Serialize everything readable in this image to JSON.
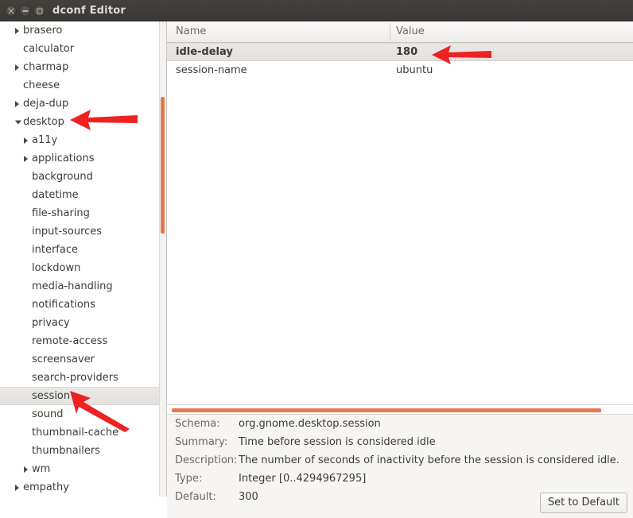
{
  "window": {
    "title": "dconf Editor",
    "controls": [
      {
        "name": "close",
        "glyph": "x"
      },
      {
        "name": "minimize",
        "glyph": "-"
      },
      {
        "name": "maximize",
        "glyph": "[]"
      }
    ]
  },
  "accent_color": "#e07a4e",
  "annotation_color": "#ee2222",
  "tree": {
    "items": [
      {
        "label": "brasero",
        "depth": 0,
        "state": "collapsed",
        "selected": false
      },
      {
        "label": "calculator",
        "depth": 0,
        "state": "leaf",
        "selected": false
      },
      {
        "label": "charmap",
        "depth": 0,
        "state": "collapsed",
        "selected": false
      },
      {
        "label": "cheese",
        "depth": 0,
        "state": "leaf",
        "selected": false
      },
      {
        "label": "deja-dup",
        "depth": 0,
        "state": "collapsed",
        "selected": false
      },
      {
        "label": "desktop",
        "depth": 0,
        "state": "expanded",
        "selected": false
      },
      {
        "label": "a11y",
        "depth": 1,
        "state": "collapsed",
        "selected": false
      },
      {
        "label": "applications",
        "depth": 1,
        "state": "collapsed",
        "selected": false
      },
      {
        "label": "background",
        "depth": 1,
        "state": "leaf",
        "selected": false
      },
      {
        "label": "datetime",
        "depth": 1,
        "state": "leaf",
        "selected": false
      },
      {
        "label": "file-sharing",
        "depth": 1,
        "state": "leaf",
        "selected": false
      },
      {
        "label": "input-sources",
        "depth": 1,
        "state": "leaf",
        "selected": false
      },
      {
        "label": "interface",
        "depth": 1,
        "state": "leaf",
        "selected": false
      },
      {
        "label": "lockdown",
        "depth": 1,
        "state": "leaf",
        "selected": false
      },
      {
        "label": "media-handling",
        "depth": 1,
        "state": "leaf",
        "selected": false
      },
      {
        "label": "notifications",
        "depth": 1,
        "state": "leaf",
        "selected": false
      },
      {
        "label": "privacy",
        "depth": 1,
        "state": "leaf",
        "selected": false
      },
      {
        "label": "remote-access",
        "depth": 1,
        "state": "leaf",
        "selected": false
      },
      {
        "label": "screensaver",
        "depth": 1,
        "state": "leaf",
        "selected": false
      },
      {
        "label": "search-providers",
        "depth": 1,
        "state": "leaf",
        "selected": false
      },
      {
        "label": "session",
        "depth": 1,
        "state": "leaf",
        "selected": true
      },
      {
        "label": "sound",
        "depth": 1,
        "state": "leaf",
        "selected": false
      },
      {
        "label": "thumbnail-cache",
        "depth": 1,
        "state": "leaf",
        "selected": false
      },
      {
        "label": "thumbnailers",
        "depth": 1,
        "state": "leaf",
        "selected": false
      },
      {
        "label": "wm",
        "depth": 1,
        "state": "collapsed",
        "selected": false
      },
      {
        "label": "empathy",
        "depth": 0,
        "state": "collapsed",
        "selected": false
      }
    ]
  },
  "table": {
    "columns": [
      "Name",
      "Value"
    ],
    "rows": [
      {
        "name": "idle-delay",
        "value": "180",
        "selected": true,
        "modified": true
      },
      {
        "name": "session-name",
        "value": "ubuntu",
        "selected": false,
        "modified": false
      }
    ]
  },
  "details": {
    "rows": [
      {
        "label": "Schema:",
        "value": "org.gnome.desktop.session"
      },
      {
        "label": "Summary:",
        "value": "Time before session is considered idle"
      },
      {
        "label": "Description:",
        "value": "The number of seconds of inactivity before the session is considered idle."
      },
      {
        "label": "Type:",
        "value": "Integer [0..4294967295]"
      },
      {
        "label": "Default:",
        "value": "300"
      }
    ],
    "set_default_label": "Set to Default"
  },
  "annotations": [
    {
      "name": "arrow-pointing-at-desktop",
      "direction": "left"
    },
    {
      "name": "arrow-pointing-at-session",
      "direction": "up-left"
    },
    {
      "name": "arrow-pointing-at-value",
      "direction": "left"
    }
  ]
}
